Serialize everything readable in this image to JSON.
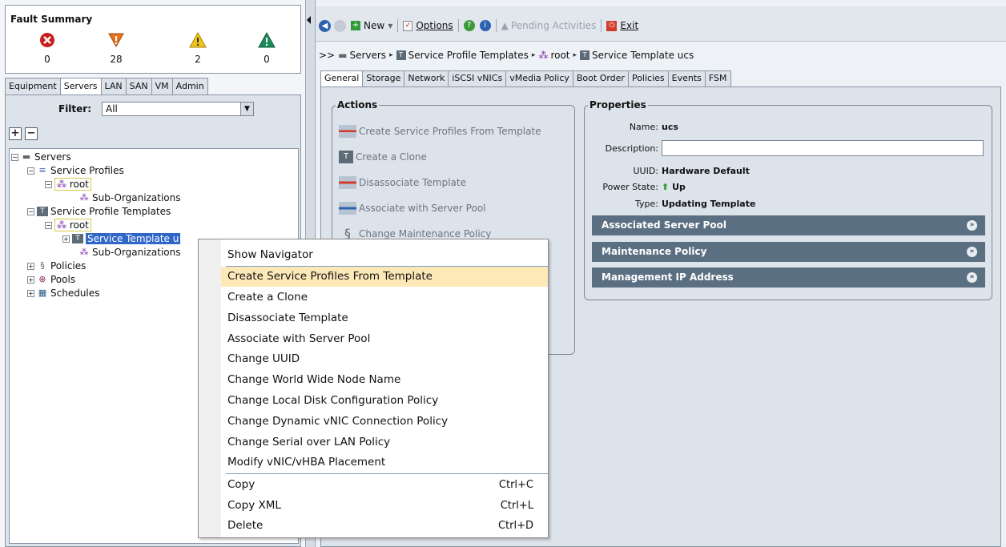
{
  "fault_summary": {
    "title": "Fault Summary",
    "items": [
      {
        "icon": "critical-x-icon",
        "color": "#c81e1e",
        "count": "0"
      },
      {
        "icon": "major-down-triangle-icon",
        "color": "#e8731a",
        "count": "28"
      },
      {
        "icon": "minor-warning-triangle-icon",
        "color": "#f0c419",
        "count": "2"
      },
      {
        "icon": "warning-triangle-icon",
        "color": "#1c8b5a",
        "count": "0"
      }
    ]
  },
  "nav_tabs": [
    "Equipment",
    "Servers",
    "LAN",
    "SAN",
    "VM",
    "Admin"
  ],
  "nav_active_tab": "Servers",
  "filter": {
    "label": "Filter:",
    "value": "All"
  },
  "tree": {
    "servers": "Servers",
    "service_profiles": "Service Profiles",
    "root1": "root",
    "sub_orgs1": "Sub-Organizations",
    "service_profile_templates": "Service Profile Templates",
    "root2": "root",
    "service_template": "Service Template u",
    "sub_orgs2": "Sub-Organizations",
    "policies": "Policies",
    "pools": "Pools",
    "schedules": "Schedules"
  },
  "toolbar": {
    "new_label": "New",
    "options_label": "Options",
    "pending_label": "Pending Activities",
    "exit_label": "Exit"
  },
  "breadcrumb": {
    "prefix": ">>",
    "items": [
      "Servers",
      "Service Profile Templates",
      "root",
      "Service Template ucs"
    ]
  },
  "content_tabs": [
    "General",
    "Storage",
    "Network",
    "iSCSI vNICs",
    "vMedia Policy",
    "Boot Order",
    "Policies",
    "Events",
    "FSM"
  ],
  "content_active_tab": "General",
  "actions": {
    "legend": "Actions",
    "items": [
      "Create Service Profiles From Template",
      "Create a Clone",
      "Disassociate Template",
      "Associate with Server Pool",
      "Change Maintenance Policy"
    ]
  },
  "properties": {
    "legend": "Properties",
    "name_label": "Name:",
    "name_value": "ucs",
    "description_label": "Description:",
    "description_value": "",
    "uuid_label": "UUID:",
    "uuid_value": "Hardware Default",
    "power_label": "Power State:",
    "power_value": "Up",
    "type_label": "Type:",
    "type_value": "Updating Template",
    "bars": [
      "Associated Server Pool",
      "Maintenance Policy",
      "Management IP Address"
    ]
  },
  "context_menu": {
    "group1": [
      "Show Navigator"
    ],
    "group2": [
      "Create Service Profiles From Template",
      "Create a Clone",
      "Disassociate Template",
      "Associate with Server Pool",
      "Change UUID",
      "Change World Wide Node Name",
      "Change Local Disk Configuration Policy",
      "Change Dynamic vNIC Connection Policy",
      "Change Serial over LAN Policy",
      "Modify vNIC/vHBA Placement"
    ],
    "group3": [
      {
        "label": "Copy",
        "shortcut": "Ctrl+C"
      },
      {
        "label": "Copy XML",
        "shortcut": "Ctrl+L"
      },
      {
        "label": "Delete",
        "shortcut": "Ctrl+D"
      }
    ],
    "highlighted": "Create Service Profiles From Template"
  }
}
